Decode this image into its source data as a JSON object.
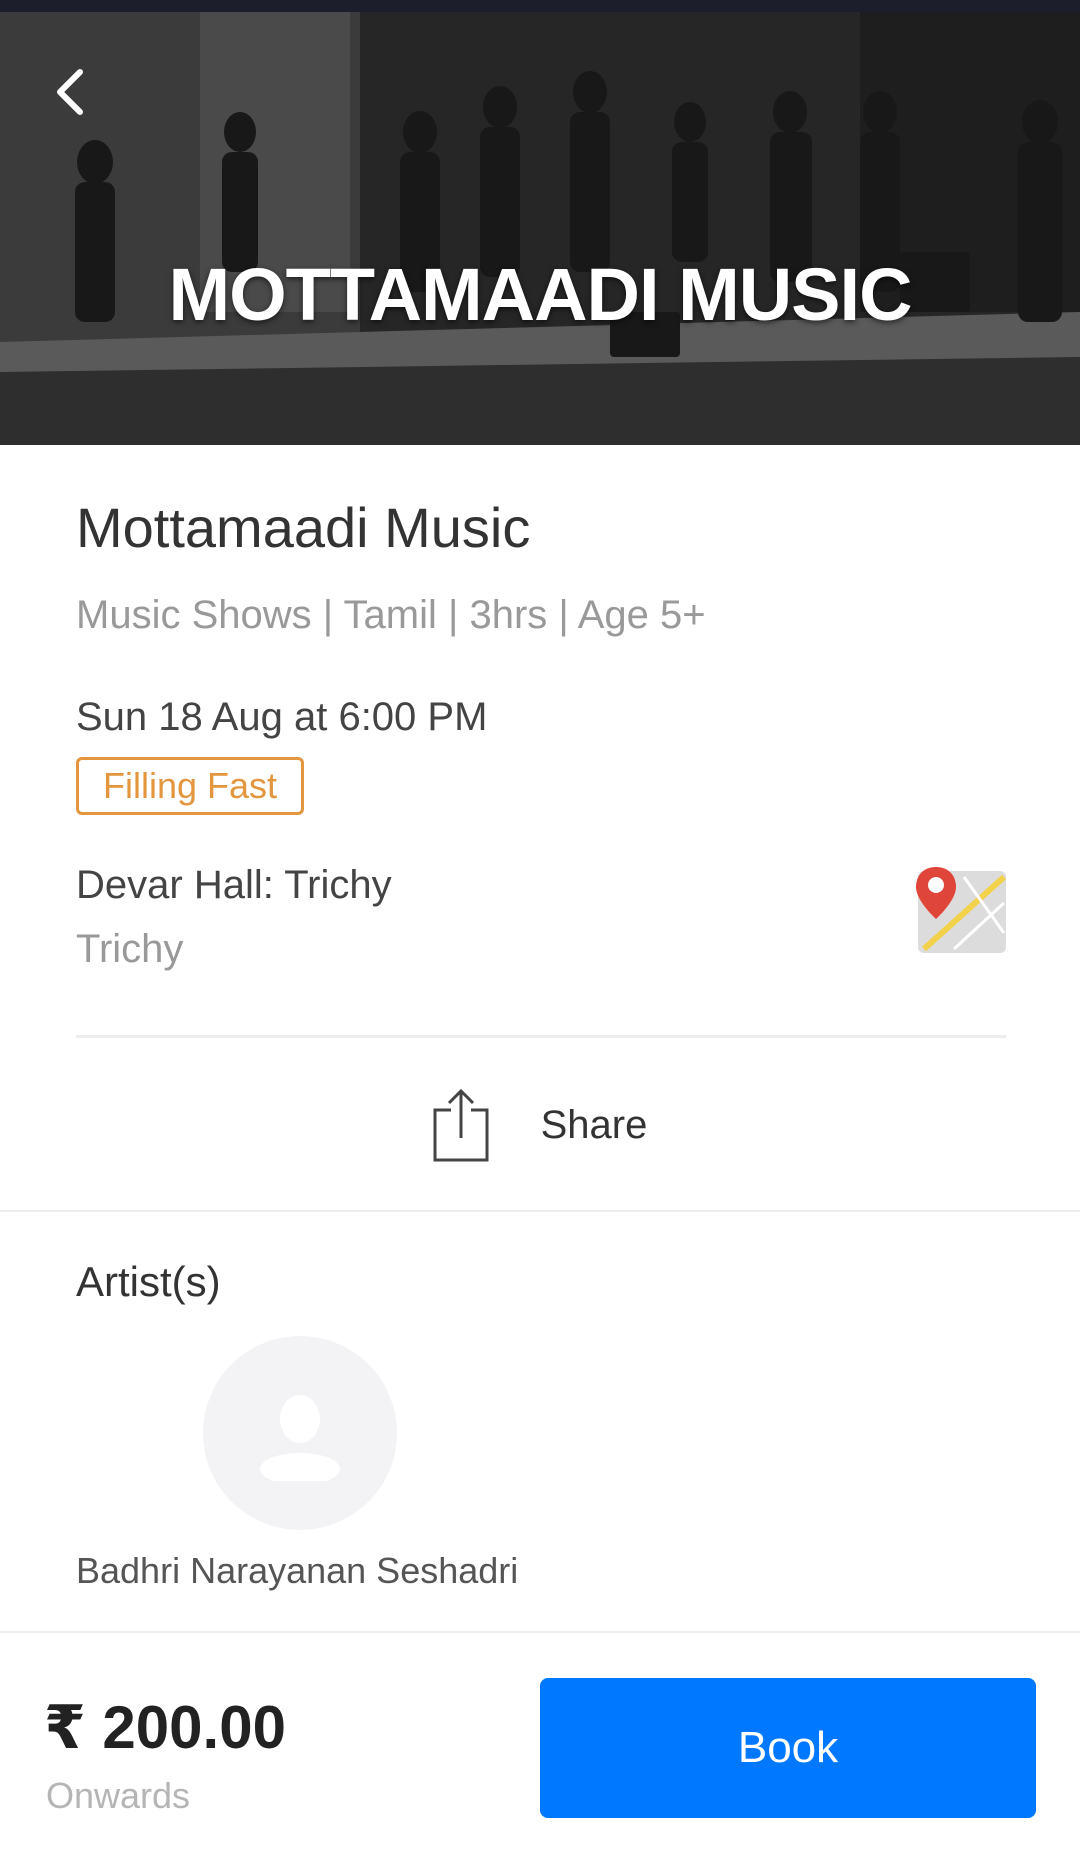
{
  "hero": {
    "banner_text": "MOTTAMAADI MUSIC",
    "back_icon": "chevron-left-icon"
  },
  "event": {
    "title": "Mottamaadi Music",
    "meta": "Music Shows | Tamil | 3hrs | Age 5+",
    "datetime": "Sun 18 Aug  at 6:00 PM",
    "badge": "Filling Fast",
    "venue": "Devar Hall: Trichy",
    "city": "Trichy",
    "map_icon": "map-pin-icon"
  },
  "share": {
    "label": "Share",
    "icon": "share-icon"
  },
  "artists": {
    "heading": "Artist(s)",
    "items": [
      {
        "name": "Badhri Narayanan Seshadri",
        "icon": "user-avatar-icon"
      }
    ]
  },
  "booking": {
    "price": "₹ 200.00",
    "price_note": "Onwards",
    "book_label": "Book"
  },
  "colors": {
    "accent": "#0078ff",
    "badge": "#e3963e",
    "status_bar": "#1c1f2b"
  }
}
